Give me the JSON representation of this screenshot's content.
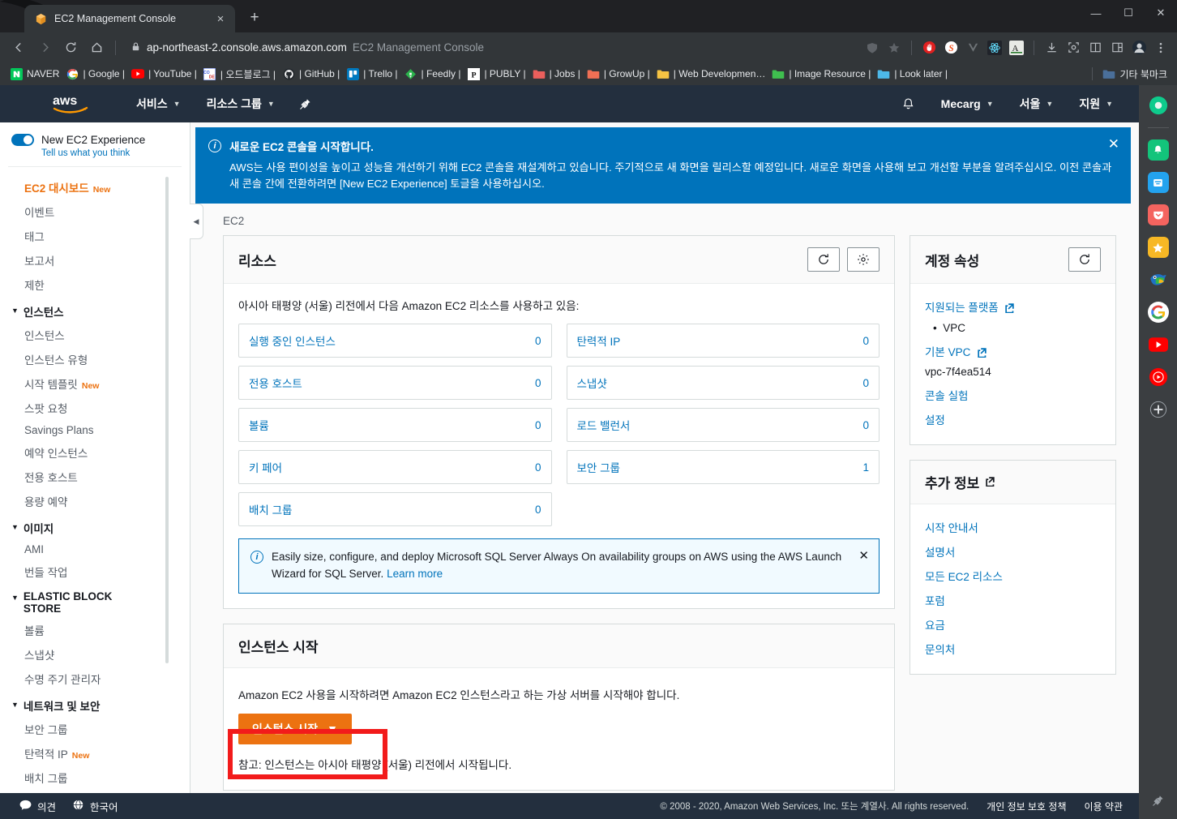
{
  "browser": {
    "tab": {
      "title": "EC2 Management Console",
      "favicon": "aws-cube-icon",
      "close": "×"
    },
    "newtab_label": "+",
    "window_controls": {
      "minimize": "—",
      "maximize": "☐",
      "close": "✕"
    },
    "toolbar": {
      "back": "‹",
      "forward": "›",
      "reload": "↻",
      "home": "⌂",
      "lock": "🔒",
      "url": "ap-northeast-2.console.aws.amazon.com",
      "url_subtitle": "EC2 Management Console",
      "extensions": [
        "shield-icon",
        "star-icon",
        "adblock-icon",
        "stylus-icon",
        "vimium-icon",
        "react-devtools-icon",
        "translate-icon",
        "download-icon",
        "screenshot-icon",
        "reader-icon",
        "split-view-icon",
        "profile-avatar-icon",
        "menu-kebab-icon"
      ]
    },
    "bookmarks": [
      {
        "icon": "naver-icon",
        "label": "NAVER"
      },
      {
        "icon": "google-icon",
        "label": "| Google |"
      },
      {
        "icon": "youtube-icon",
        "label": "| YouTube |"
      },
      {
        "icon": "code-icon",
        "label": "| 오드블로그 |"
      },
      {
        "icon": "github-icon",
        "label": "| GitHub |"
      },
      {
        "icon": "trello-icon",
        "label": "| Trello |"
      },
      {
        "icon": "feedly-icon",
        "label": "| Feedly |"
      },
      {
        "icon": "publy-icon",
        "label": "| PUBLY |"
      },
      {
        "icon": "folder-red-icon",
        "label": "| Jobs |"
      },
      {
        "icon": "folder-salmon-icon",
        "label": "| GrowUp |"
      },
      {
        "icon": "folder-yellow-icon",
        "label": "| Web Developmen…"
      },
      {
        "icon": "folder-green-icon",
        "label": "| Image Resource |"
      },
      {
        "icon": "folder-blue-icon",
        "label": "| Look later |"
      }
    ],
    "bookmarks_other": {
      "icon": "folder-icon",
      "label": "기타 북마크"
    }
  },
  "aws_nav": {
    "logo": "aws",
    "services": "서비스",
    "resource_groups": "리소스 그룹",
    "pin_icon": "pushpin-icon",
    "bell_icon": "bell-icon",
    "account": "Mecarg",
    "region": "서울",
    "support": "지원"
  },
  "sidebar": {
    "new_experience": {
      "title": "New EC2 Experience",
      "sub": "Tell us what you think",
      "toggle_on": true
    },
    "items": [
      {
        "label": "EC2 대시보드",
        "badge": "New",
        "active": true,
        "type": "link"
      },
      {
        "label": "이벤트",
        "type": "link"
      },
      {
        "label": "태그",
        "type": "link"
      },
      {
        "label": "보고서",
        "type": "link"
      },
      {
        "label": "제한",
        "type": "link"
      },
      {
        "label": "인스턴스",
        "type": "group"
      },
      {
        "label": "인스턴스",
        "type": "link"
      },
      {
        "label": "인스턴스 유형",
        "type": "link"
      },
      {
        "label": "시작 템플릿",
        "badge": "New",
        "type": "link"
      },
      {
        "label": "스팟 요청",
        "type": "link"
      },
      {
        "label": "Savings Plans",
        "type": "link"
      },
      {
        "label": "예약 인스턴스",
        "type": "link"
      },
      {
        "label": "전용 호스트",
        "type": "link"
      },
      {
        "label": "용량 예약",
        "type": "link"
      },
      {
        "label": "이미지",
        "type": "group"
      },
      {
        "label": "AMI",
        "type": "link"
      },
      {
        "label": "번들 작업",
        "type": "link"
      },
      {
        "label": "ELASTIC BLOCK STORE",
        "type": "group"
      },
      {
        "label": "볼륨",
        "type": "link"
      },
      {
        "label": "스냅샷",
        "type": "link"
      },
      {
        "label": "수명 주기 관리자",
        "type": "link"
      },
      {
        "label": "네트워크 및 보안",
        "type": "group"
      },
      {
        "label": "보안 그룹",
        "type": "link"
      },
      {
        "label": "탄력적 IP",
        "badge": "New",
        "type": "link"
      },
      {
        "label": "배치 그룹",
        "type": "link"
      }
    ],
    "collapse_icon": "◀"
  },
  "banner": {
    "icon": "info-icon",
    "title": "새로운 EC2 콘솔을 시작합니다.",
    "text": "AWS는 사용 편이성을 높이고 성능을 개선하기 위해 EC2 콘솔을 재설계하고 있습니다. 주기적으로 새 화면을 릴리스할 예정입니다. 새로운 화면을 사용해 보고 개선할 부분을 알려주십시오. 이전 콘솔과 새 콘솔 간에 전환하려면 [New EC2 Experience] 토글을 사용하십시오.",
    "close": "✕"
  },
  "breadcrumb": "EC2",
  "resources_card": {
    "title": "리소스",
    "refresh_icon": "refresh-icon",
    "settings_icon": "gear-icon",
    "note": "아시아 태평양 (서울) 리전에서 다음 Amazon EC2 리소스를 사용하고 있음:",
    "items": [
      {
        "label": "실행 중인 인스턴스",
        "count": "0"
      },
      {
        "label": "탄력적 IP",
        "count": "0"
      },
      {
        "label": "전용 호스트",
        "count": "0"
      },
      {
        "label": "스냅샷",
        "count": "0"
      },
      {
        "label": "볼륨",
        "count": "0"
      },
      {
        "label": "로드 밸런서",
        "count": "0"
      },
      {
        "label": "키 페어",
        "count": "0"
      },
      {
        "label": "보안 그룹",
        "count": "1"
      },
      {
        "label": "배치 그룹",
        "count": "0"
      }
    ],
    "info_box": {
      "icon": "info-icon",
      "text": "Easily size, configure, and deploy Microsoft SQL Server Always On availability groups on AWS using the AWS Launch Wizard for SQL Server.",
      "link": "Learn more",
      "close": "✕"
    }
  },
  "launch_card": {
    "title": "인스턴스 시작",
    "desc": "Amazon EC2 사용을 시작하려면 Amazon EC2 인스턴스라고 하는 가상 서버를 시작해야 합니다.",
    "button": "인스턴스 시작",
    "button_caret": "▼",
    "note": "참고: 인스턴스는 아시아 태평양 (서울) 리전에서 시작됩니다.",
    "highlight_color": "#f21b1b"
  },
  "account_card": {
    "title": "계정 속성",
    "refresh_icon": "refresh-icon",
    "supported_platforms": "지원되는 플랫폼",
    "platform_value": "VPC",
    "default_vpc": "기본 VPC",
    "vpc_id": "vpc-7f4ea514",
    "links": [
      "콘솔 실험",
      "설정"
    ]
  },
  "additional_card": {
    "title": "추가 정보",
    "links": [
      "시작 안내서",
      "설명서",
      "모든 EC2 리소스",
      "포럼",
      "요금",
      "문의처"
    ]
  },
  "footer": {
    "feedback_icon": "speech-bubble-icon",
    "feedback": "의견",
    "globe_icon": "globe-icon",
    "language": "한국어",
    "copyright": "© 2008 - 2020, Amazon Web Services, Inc. 또는 계열사. All rights reserved.",
    "privacy": "개인 정보 보호 정책",
    "terms": "이용 약관"
  },
  "rail": {
    "icons": [
      "sidebery-icon",
      "notification-bell-icon",
      "pocket-box-icon",
      "pocket-icon",
      "star-favorites-icon",
      "bird-icon",
      "google-icon",
      "youtube-icon",
      "youtube-play-icon",
      "add-icon"
    ]
  },
  "colors": {
    "aws_navy": "#232f3e",
    "aws_orange": "#ec7211",
    "link_blue": "#0073bb",
    "banner_blue": "#0073bb",
    "highlight_red": "#f21b1b"
  }
}
